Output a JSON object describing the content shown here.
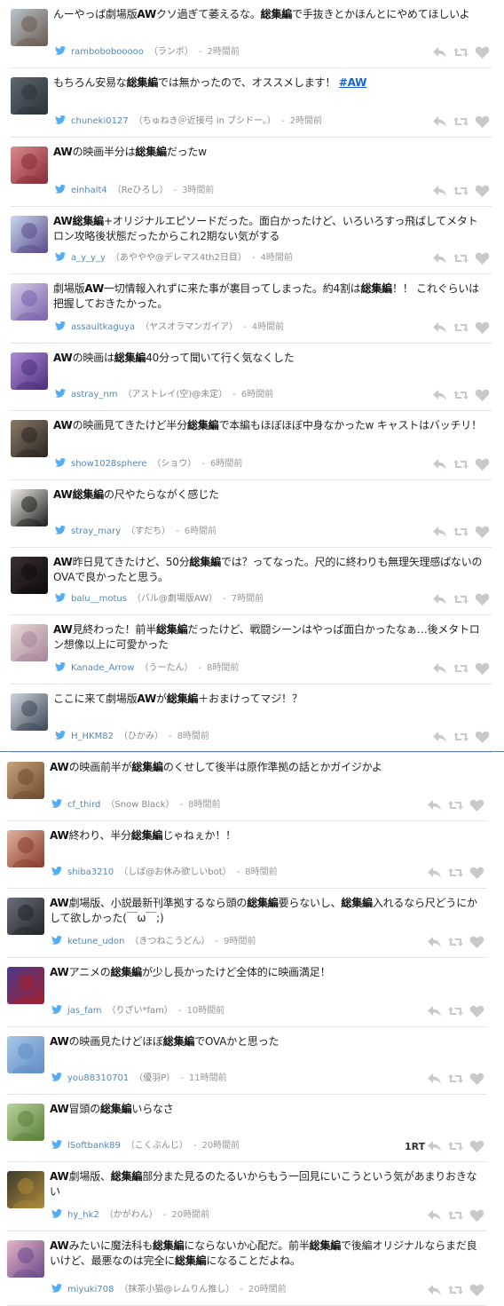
{
  "colors": {
    "bird": "#55acee",
    "link": "#1a63c9",
    "divider": "#5b7fa6",
    "icon": "#c9c9c9"
  },
  "tweets": [
    {
      "segs": [
        {
          "t": "んーやっぱ劇場版"
        },
        {
          "t": "AW",
          "b": true
        },
        {
          "t": "クソ過ぎて萎えるな。"
        },
        {
          "t": "総集編",
          "b": true
        },
        {
          "t": "で手抜きとかほんとにやめてほしいよ"
        }
      ],
      "handle": "rambobobooooo",
      "name": "（ランボ）",
      "time": "2時間前",
      "av": [
        "#b9c4cc",
        "#6b5a4f"
      ]
    },
    {
      "segs": [
        {
          "t": "もちろん安易な"
        },
        {
          "t": "総集編",
          "b": true
        },
        {
          "t": "では無かったので、オススメします！ "
        },
        {
          "t": "#AW",
          "a": true
        }
      ],
      "handle": "chuneki0127",
      "name": "（ちゅねき＠近接弓 in ブシドー。）",
      "time": "2時間前",
      "av": [
        "#5c6770",
        "#2b333a"
      ]
    },
    {
      "segs": [
        {
          "t": "AW",
          "b": true
        },
        {
          "t": "の映画半分は"
        },
        {
          "t": "総集編",
          "b": true
        },
        {
          "t": "だったw"
        }
      ],
      "handle": "einhalt4",
      "name": "（Reひろし）",
      "time": "3時間前",
      "av": [
        "#d98a8a",
        "#8a2b3a"
      ]
    },
    {
      "segs": [
        {
          "t": "AW総集編",
          "b": true
        },
        {
          "t": "+オリジナルエピソードだった。面白かったけど、いろいろすっ飛ばしてメタトロン攻略後状態だったからこれ2期ない気がする"
        }
      ],
      "handle": "a_y_y_y",
      "name": "（あややや@デレマス4th2日目）",
      "time": "4時間前",
      "av": [
        "#c9d8f0",
        "#5a4a8a"
      ]
    },
    {
      "segs": [
        {
          "t": "劇場版"
        },
        {
          "t": "AW",
          "b": true
        },
        {
          "t": "一切情報入れずに来た事が裏目ってしまった。約4割は"
        },
        {
          "t": "総集編",
          "b": true
        },
        {
          "t": "！！ これぐらいは把握しておきたかった。"
        }
      ],
      "handle": "assaultkaguya",
      "name": "（ヤスオラマンガイア）",
      "time": "4時間前",
      "av": [
        "#d7d2e8",
        "#7a5fae"
      ]
    },
    {
      "segs": [
        {
          "t": "AW",
          "b": true
        },
        {
          "t": "の映画は"
        },
        {
          "t": "総集編",
          "b": true
        },
        {
          "t": "40分って聞いて行く気なくした"
        }
      ],
      "handle": "astray_nm",
      "name": "（アストレイ(空)@未定）",
      "time": "6時間前",
      "av": [
        "#b08ad8",
        "#4a2f7a"
      ]
    },
    {
      "segs": [
        {
          "t": "AW",
          "b": true
        },
        {
          "t": "の映画見てきたけど半分"
        },
        {
          "t": "総集編",
          "b": true
        },
        {
          "t": "で本編もほぼほぼ中身なかったw キャストはバッチリ！"
        }
      ],
      "handle": "show1028sphere",
      "name": "（ショウ）",
      "time": "6時間前",
      "av": [
        "#8a7a66",
        "#2a2522"
      ]
    },
    {
      "segs": [
        {
          "t": "AW総集編",
          "b": true
        },
        {
          "t": "の尺やたらながく感じた"
        }
      ],
      "handle": "stray_mary",
      "name": "（すだち）",
      "time": "6時間前",
      "av": [
        "#f0efe8",
        "#1d1d1d"
      ]
    },
    {
      "segs": [
        {
          "t": "AW",
          "b": true
        },
        {
          "t": "昨日見てきたけど、50分"
        },
        {
          "t": "総集編",
          "b": true
        },
        {
          "t": "では？ってなった。尺的に終わりも無理矢理感ぱないの OVAで良かったと思う。"
        }
      ],
      "handle": "balu__motus",
      "name": "（バル@劇場版AW）",
      "time": "7時間前",
      "av": [
        "#3a3030",
        "#0e0b0b"
      ]
    },
    {
      "segs": [
        {
          "t": "AW",
          "b": true
        },
        {
          "t": "見終わった！前半"
        },
        {
          "t": "総集編",
          "b": true
        },
        {
          "t": "だったけど、戦闘シーンはやっぱ面白かったなぁ…後メタトロン想像以上に可愛かった"
        }
      ],
      "handle": "Kanade_Arrow",
      "name": "（うーたん）",
      "time": "8時間前",
      "av": [
        "#e9dcd6",
        "#a7849a"
      ]
    },
    {
      "segs": [
        {
          "t": "ここに来て劇場版"
        },
        {
          "t": "AW",
          "b": true
        },
        {
          "t": "が"
        },
        {
          "t": "総集編",
          "b": true
        },
        {
          "t": "＋おまけってマジ！？"
        }
      ],
      "handle": "H_HKM82",
      "name": "（ひかみ）",
      "time": "8時間前",
      "av": [
        "#cfd4dc",
        "#3b4656"
      ]
    },
    {
      "segs": [
        {
          "t": "AW",
          "b": true
        },
        {
          "t": "の映画前半が"
        },
        {
          "t": "総集編",
          "b": true
        },
        {
          "t": "のくせして後半は原作準拠の話とかガイジかよ"
        }
      ],
      "handle": "cf_third",
      "name": "（Snow Black）",
      "time": "8時間前",
      "av": [
        "#c7a27a",
        "#6e4a2c"
      ]
    },
    {
      "segs": [
        {
          "t": "AW",
          "b": true
        },
        {
          "t": "終わり、半分"
        },
        {
          "t": "総集編",
          "b": true
        },
        {
          "t": "じゃねぇか！！"
        }
      ],
      "handle": "shiba3210",
      "name": "（しば@お休み欲しいbot）",
      "time": "8時間前",
      "av": [
        "#e0b3a0",
        "#8a3a2a"
      ]
    },
    {
      "segs": [
        {
          "t": "AW",
          "b": true
        },
        {
          "t": "劇場版、小説最新刊準拠するなら頭の"
        },
        {
          "t": "総集編",
          "b": true
        },
        {
          "t": "要らないし、"
        },
        {
          "t": "総集編",
          "b": true
        },
        {
          "t": "入れるなら尺どうにかして欲しかった(￣ω￣;)"
        }
      ],
      "handle": "ketune_udon",
      "name": "（きつねこうどん）",
      "time": "9時間前",
      "av": [
        "#6b6f7a",
        "#23252b"
      ]
    },
    {
      "segs": [
        {
          "t": "AW",
          "b": true
        },
        {
          "t": "アニメの"
        },
        {
          "t": "総集編",
          "b": true
        },
        {
          "t": "が少し長かったけど全体的に映画満足！"
        }
      ],
      "handle": "jas_fam",
      "name": "（りざい*fam）",
      "time": "10時間前",
      "av": [
        "#4a3a8a",
        "#a02030"
      ]
    },
    {
      "segs": [
        {
          "t": "AW",
          "b": true
        },
        {
          "t": "の映画見たけどほぼ"
        },
        {
          "t": "総集編",
          "b": true
        },
        {
          "t": "でOVAかと思った"
        }
      ],
      "handle": "you88310701",
      "name": "（優羽P）",
      "time": "11時間前",
      "av": [
        "#a9c6e8",
        "#5f8ec4"
      ]
    },
    {
      "segs": [
        {
          "t": "AW",
          "b": true
        },
        {
          "t": "冒頭の"
        },
        {
          "t": "総集編",
          "b": true
        },
        {
          "t": "いらなさ"
        }
      ],
      "handle": "lSoftbank89",
      "name": "（こくぶんじ）",
      "time": "20時間前",
      "av": [
        "#b6d49a",
        "#5b7f3a"
      ],
      "rt": "1RT"
    },
    {
      "segs": [
        {
          "t": "AW",
          "b": true
        },
        {
          "t": "劇場版、"
        },
        {
          "t": "総集編",
          "b": true
        },
        {
          "t": "部分また見るのたるいからもう一回見にいこうという気があまりおきない"
        }
      ],
      "handle": "hy_hk2",
      "name": "（かがわん）",
      "time": "20時間前",
      "av": [
        "#3a3a2a",
        "#b08a3a"
      ]
    },
    {
      "segs": [
        {
          "t": "AW",
          "b": true
        },
        {
          "t": "みたいに魔法科も"
        },
        {
          "t": "総集編",
          "b": true
        },
        {
          "t": "にならないか心配だ。前半"
        },
        {
          "t": "総集編",
          "b": true
        },
        {
          "t": "で後編オリジナルならまだ良いけど、最悪なのは完全に"
        },
        {
          "t": "総集編",
          "b": true
        },
        {
          "t": "になることだよね。"
        }
      ],
      "handle": "miyuki708",
      "name": "（抹茶小猫@レムりん推し）",
      "time": "20時間前",
      "av": [
        "#e6b3c8",
        "#6a4a8a"
      ]
    }
  ]
}
